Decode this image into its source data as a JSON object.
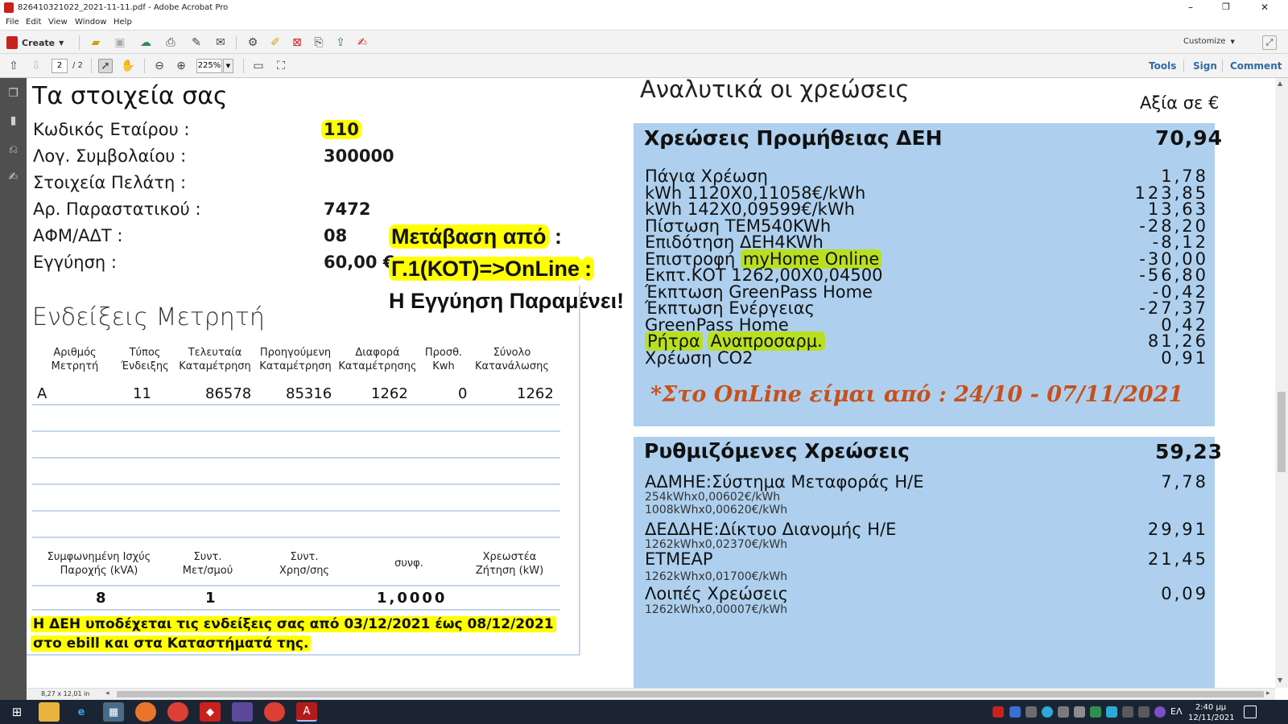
{
  "window": {
    "title": "826410321022_2021-11-11.pdf - Adobe Acrobat Pro"
  },
  "menu": [
    "File",
    "Edit",
    "View",
    "Window",
    "Help"
  ],
  "toolbar": {
    "create_label": "Create",
    "customize_label": "Customize",
    "page_current": "2",
    "page_total": "/ 2",
    "zoom": "225%",
    "tools_label": "Tools",
    "sign_label": "Sign",
    "comment_label": "Comment"
  },
  "status": {
    "page_size": "8,27 x 12,01 in"
  },
  "taskbar": {
    "lang": "ΕΛ",
    "time": "2:40 μμ",
    "date": "12/11/2021"
  },
  "left": {
    "title": "Τα στοιχεία σας",
    "fields": [
      {
        "label": "Κωδικός Εταίρου :",
        "value": "110"
      },
      {
        "label": "Λογ. Συμβολαίου :",
        "value": "300000"
      },
      {
        "label": "Στοιχεία Πελάτη :",
        "value": ""
      },
      {
        "label": "Αρ. Παραστατικού :",
        "value": "7472"
      },
      {
        "label": "ΑΦΜ/ΑΔΤ :",
        "value": "08"
      },
      {
        "label": "Εγγύηση :",
        "value": "60,00 €"
      }
    ],
    "annotation": {
      "line1": "Μετάβαση από",
      "line1_tail": ":",
      "line2": "Γ.1(ΚΟΤ)=>OnLine",
      "line2_tail": ":",
      "line3": "Η Εγγύηση Παραμένει!"
    },
    "meter": {
      "title": "Ενδείξεις Μετρητή",
      "headers": [
        "Αριθμός\nΜετρητή",
        "Τύπος\nΈνδειξης",
        "Τελευταία\nΚαταμέτρηση",
        "Προηγούμενη\nΚαταμέτρηση",
        "Διαφορά\nΚαταμέτρησης",
        "Προσθ.\nKwh",
        "Σύνολο\nΚατανάλωσης"
      ],
      "row": [
        "A",
        "11",
        "86578",
        "85316",
        "1262",
        "0",
        "1262"
      ],
      "headers2": [
        "Συμφωνημένη Ισχύς\nΠαροχής (kVA)",
        "Συντ.\nΜετ/σμού",
        "Συντ.\nΧρησ/σης",
        "συνφ.",
        "Χρεωστέα\nΖήτηση (kW)"
      ],
      "row2": [
        "8",
        "1",
        "",
        "1,0000",
        ""
      ],
      "notice_line1": "Η ΔΕΗ υποδέχεται τις ενδείξεις σας από 03/12/2021 έως 08/12/2021",
      "notice_line2": "στο ebill και στα Καταστήματά της."
    }
  },
  "right": {
    "title": "Αναλυτικά οι χρεώσεις",
    "value_header": "Αξία σε €",
    "supply": {
      "title": "Χρεώσεις Προμήθειας ΔΕΗ",
      "total": "70,94",
      "lines": [
        {
          "label": "Πάγια Χρέωση",
          "amount": "1,78"
        },
        {
          "label": "kWh 1120X0,11058€/kWh",
          "amount": "123,85"
        },
        {
          "label": "kWh 142X0,09599€/kWh",
          "amount": "13,63"
        },
        {
          "label": "Πίστωση ΤΕΜ540KWh",
          "amount": "-28,20"
        },
        {
          "label": "Επιδότηση ΔΕΗ4KWh",
          "amount": "-8,12"
        },
        {
          "label": "Επιστροφή ",
          "label_hl": "myHome Online",
          "amount": "-30,00"
        },
        {
          "label": "Εκπτ.ΚΟΤ 1262,00X0,04500",
          "amount": "-56,80"
        },
        {
          "label": "Έκπτωση GreenPass Home",
          "amount": "-0,42"
        },
        {
          "label": "Έκπτωση Ενέργειας",
          "amount": "-27,37"
        },
        {
          "label": "GreenPass Home",
          "amount": "0,42"
        },
        {
          "label": "Ρήτρα",
          "label_hl": "Αναπροσαρμ.",
          "amount": "81,26"
        },
        {
          "label": "Χρέωση CO2",
          "amount": "0,91"
        }
      ],
      "note": "*Στο OnLine είμαι από : 24/10 - 07/11/2021"
    },
    "regulated": {
      "title": "Ρυθμιζόμενες Χρεώσεις",
      "total": "59,23",
      "lines": [
        {
          "label": "ΑΔΜΗΕ:Σύστημα Μεταφοράς Η/Ε",
          "amount": "7,78",
          "details": [
            "254kWhx0,00602€/kWh",
            "1008kWhx0,00620€/kWh"
          ]
        },
        {
          "label": "ΔΕΔΔΗΕ:Δίκτυο Διανομής Η/Ε",
          "amount": "29,91",
          "details": [
            "1262kWhx0,02370€/kWh"
          ]
        },
        {
          "label": "ΕΤΜΕΑΡ",
          "amount": "21,45",
          "details": [
            "1262kWhx0,01700€/kWh"
          ]
        },
        {
          "label": "Λοιπές Χρεώσεις",
          "amount": "0,09",
          "details": [
            "1262kWhx0,00007€/kWh"
          ]
        }
      ]
    }
  },
  "colors": {
    "highlight_yellow": "#ffff00",
    "highlight_green": "#b9e020",
    "panel_blue": "#aed0ee",
    "note_orange": "#c8501a"
  }
}
